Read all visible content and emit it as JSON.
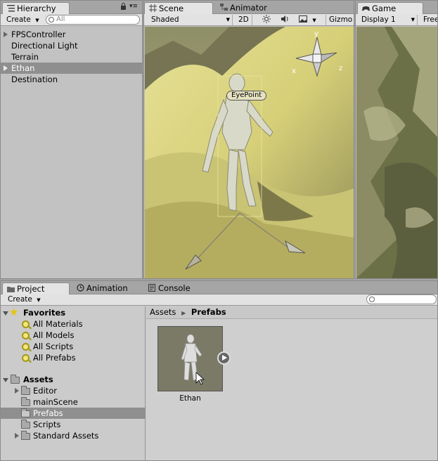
{
  "hierarchy": {
    "tab_label": "Hierarchy",
    "create_label": "Create",
    "search_placeholder": "All",
    "items": [
      {
        "label": "FPSController",
        "expandable": true
      },
      {
        "label": "Directional Light",
        "expandable": false
      },
      {
        "label": "Terrain",
        "expandable": false
      },
      {
        "label": "Ethan",
        "expandable": true,
        "selected": true
      },
      {
        "label": "Destination",
        "expandable": false
      }
    ]
  },
  "scene": {
    "tabs": [
      {
        "label": "Scene",
        "icon": "scene-grid-icon",
        "active": true
      },
      {
        "label": "Animator",
        "icon": "animator-icon",
        "active": false
      }
    ],
    "toolbar": {
      "shading_mode": "Shaded",
      "mode_2d": "2D",
      "gizmos_label": "Gizmo"
    },
    "eyepoint_label": "EyePoint",
    "axis_labels": {
      "y": "y",
      "x": "x",
      "z": "z"
    }
  },
  "game": {
    "tab_label": "Game",
    "tab_icon": "game-controller-icon",
    "display_label": "Display 1",
    "aspect_label": "Free"
  },
  "project": {
    "tabs": [
      {
        "label": "Project",
        "icon": "folder-icon",
        "active": true
      },
      {
        "label": "Animation",
        "icon": "clock-icon",
        "active": false
      },
      {
        "label": "Console",
        "icon": "console-icon",
        "active": false
      }
    ],
    "create_label": "Create",
    "favorites": {
      "label": "Favorites",
      "items": [
        "All Materials",
        "All Models",
        "All Scripts",
        "All Prefabs"
      ]
    },
    "assets": {
      "label": "Assets",
      "items": [
        {
          "label": "Editor",
          "expandable": true
        },
        {
          "label": "mainScene",
          "expandable": false
        },
        {
          "label": "Prefabs",
          "expandable": false,
          "selected": true
        },
        {
          "label": "Scripts",
          "expandable": false
        },
        {
          "label": "Standard Assets",
          "expandable": true
        }
      ]
    },
    "breadcrumb": {
      "root": "Assets",
      "current": "Prefabs"
    },
    "asset_tiles": [
      {
        "label": "Ethan"
      }
    ]
  },
  "colors": {
    "selection": "#8f8f8f",
    "panel_bg": "#c2c2c2",
    "favorite_star": "#e7c400"
  }
}
